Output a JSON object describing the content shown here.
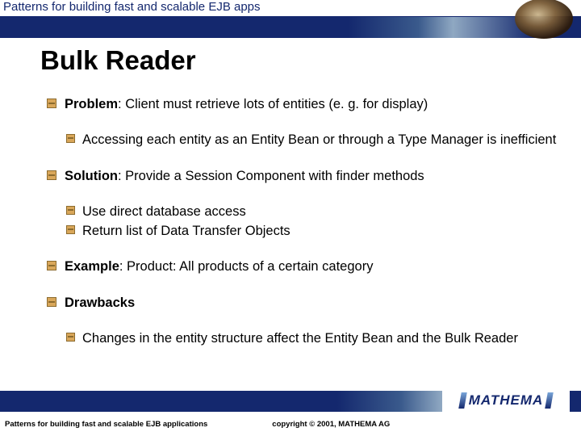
{
  "header": {
    "title": "Patterns for building fast and scalable EJB apps"
  },
  "slide": {
    "title": "Bulk Reader",
    "items": [
      {
        "label_bold": "Problem",
        "label_rest": ": Client must retrieve lots of entities (e. g. for display)",
        "children": [
          "Accessing each entity as an Entity Bean or through a Type Manager is inefficient"
        ]
      },
      {
        "label_bold": "Solution",
        "label_rest": ": Provide a Session Component with finder methods",
        "children": [
          "Use direct database access",
          "Return list of Data Transfer Objects"
        ]
      },
      {
        "label_bold": "Example",
        "label_rest": ": Product: All products of a certain category",
        "children": []
      },
      {
        "label_bold": "Drawbacks",
        "label_rest": "",
        "children": [
          "Changes in the entity structure affect the Entity Bean and the Bulk Reader"
        ]
      }
    ]
  },
  "footer": {
    "left": "Patterns for building fast and scalable EJB applications",
    "center": "copyright © 2001, MATHEMA AG",
    "logo": "MATHEMA"
  }
}
